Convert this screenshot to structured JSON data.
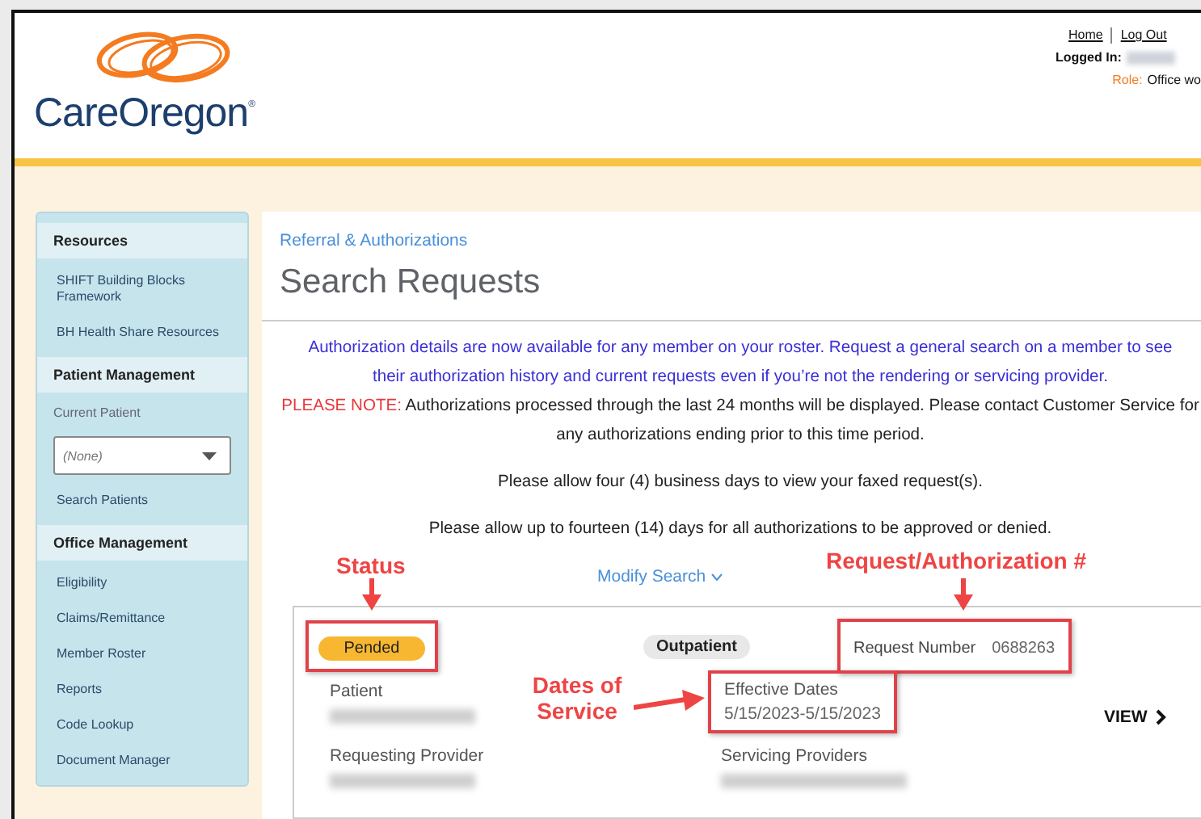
{
  "header": {
    "logo_text": "CareOregon$^{®}$",
    "links": [
      "Home",
      "Log Out"
    ],
    "logged_in_label": "Logged In:",
    "role_label": "Role:",
    "role_value": "Office wo"
  },
  "sidebar": {
    "sections": [
      {
        "title": "Resources",
        "items": [
          {
            "kind": "link",
            "label": "SHIFT Building Blocks Framework"
          },
          {
            "kind": "link",
            "label": "BH Health Share Resources"
          }
        ]
      },
      {
        "title": "Patient Management",
        "items": [
          {
            "kind": "label",
            "label": "Current Patient"
          },
          {
            "kind": "select",
            "label": "(None)"
          },
          {
            "kind": "link",
            "label": "Search Patients"
          }
        ]
      },
      {
        "title": "Office Management",
        "items": [
          {
            "kind": "link",
            "label": "Eligibility"
          },
          {
            "kind": "link",
            "label": "Claims/Remittance"
          },
          {
            "kind": "link",
            "label": "Member Roster"
          },
          {
            "kind": "link",
            "label": "Reports"
          },
          {
            "kind": "link",
            "label": "Code Lookup"
          },
          {
            "kind": "link",
            "label": "Document Manager"
          }
        ]
      }
    ]
  },
  "content": {
    "breadcrumb": "Referral & Authorizations",
    "title": "Search Requests",
    "notice": "Authorization details are now available for any member on your roster. Request a general search on a member to see their authorization history and current requests even if you’re not the rendering or servicing provider.",
    "note_label": "PLEASE NOTE:",
    "note_text": "Authorizations processed through the last 24 months will be displayed. Please contact Customer Service for any authorizations ending prior to this time period.",
    "info": [
      "Please allow four (4) business days to view your faxed request(s).",
      "Please allow up to fourteen (14) days for all authorizations to be approved or denied."
    ],
    "modify_search": "Modify Search",
    "result": {
      "status": "Pended",
      "type": "Outpatient",
      "request_number_label": "Request Number",
      "request_number": "0688263",
      "patient_label": "Patient",
      "effective_dates_label": "Effective Dates",
      "effective_dates": "5/15/2023-5/15/2023",
      "view": "VIEW",
      "requesting_provider_label": "Requesting Provider",
      "servicing_providers_label": "Servicing Providers"
    }
  },
  "annotations": [
    "Status",
    "Request/Authorization #",
    "Dates of Service"
  ]
}
